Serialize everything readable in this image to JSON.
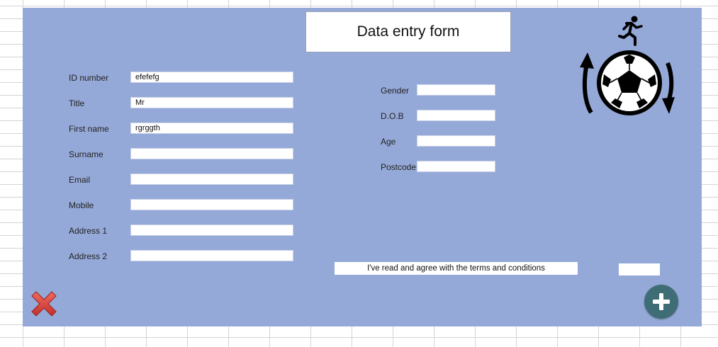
{
  "form": {
    "title": "Data entry form",
    "left_fields": [
      {
        "label": "ID number",
        "value": "efefefg"
      },
      {
        "label": "Title",
        "value": "Mr"
      },
      {
        "label": "First name",
        "value": "rgrggth"
      },
      {
        "label": "Surname",
        "value": ""
      },
      {
        "label": "Email",
        "value": ""
      },
      {
        "label": "Mobile",
        "value": ""
      },
      {
        "label": "Address 1",
        "value": ""
      },
      {
        "label": "Address 2",
        "value": ""
      }
    ],
    "right_fields": [
      {
        "label": "Gender",
        "value": ""
      },
      {
        "label": "D.O.B",
        "value": ""
      },
      {
        "label": "Age",
        "value": ""
      },
      {
        "label": "Postcode",
        "value": ""
      }
    ],
    "terms_text": "I've read and agree with the terms and conditions",
    "terms_value": ""
  },
  "icons": {
    "logo": "soccer-ball-runner-icon",
    "cancel": "red-x-icon",
    "add": "plus-icon"
  },
  "colors": {
    "panel": "#95a9d8",
    "cancel": "#d9413a",
    "add": "#3f6d76"
  }
}
